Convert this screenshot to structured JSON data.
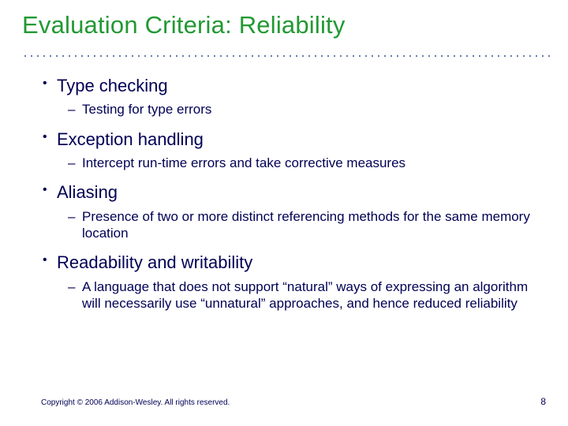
{
  "title": "Evaluation Criteria: Reliability",
  "bullets": [
    {
      "text": "Type checking",
      "sub": "Testing for type errors"
    },
    {
      "text": "Exception handling",
      "sub": "Intercept run-time errors and take corrective measures"
    },
    {
      "text": "Aliasing",
      "sub": "Presence of two or more distinct referencing methods for the same memory location"
    },
    {
      "text": "Readability and writability",
      "sub": "A language that does not support “natural” ways of expressing an algorithm will necessarily use “unnatural” approaches, and hence reduced reliability"
    }
  ],
  "footer": {
    "copyright": "Copyright © 2006 Addison-Wesley. All rights reserved.",
    "page": "8"
  }
}
